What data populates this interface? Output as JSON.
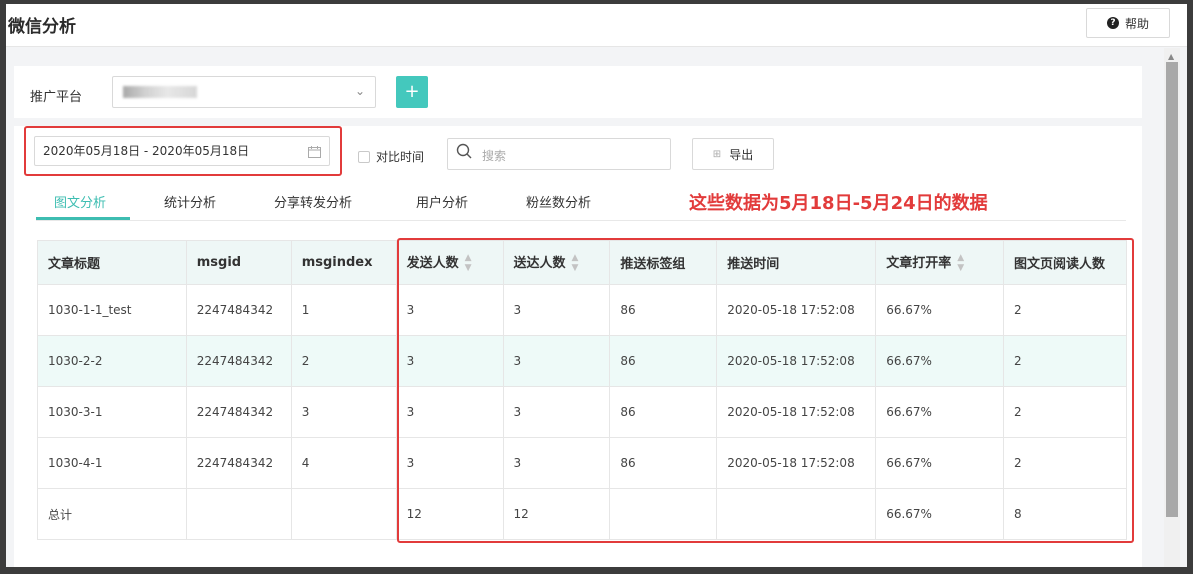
{
  "header": {
    "title": "微信分析",
    "help_label": "帮助"
  },
  "filters": {
    "platform_label": "推广平台",
    "date_range": "2020年05月18日 - 2020年05月18日",
    "compare_label": "对比时间",
    "search_placeholder": "搜索",
    "export_label": "导出"
  },
  "tabs": [
    {
      "label": "图文分析",
      "active": true
    },
    {
      "label": "统计分析"
    },
    {
      "label": "分享转发分析"
    },
    {
      "label": "用户分析"
    },
    {
      "label": "粉丝数分析"
    }
  ],
  "annotation": "这些数据为5月18日-5月24日的数据",
  "table": {
    "columns": [
      "文章标题",
      "msgid",
      "msgindex",
      "发送人数",
      "送达人数",
      "推送标签组",
      "推送时间",
      "文章打开率",
      "图文页阅读人数"
    ],
    "rows": [
      [
        "1030-1-1_test",
        "2247484342",
        "1",
        "3",
        "3",
        "86",
        "2020-05-18 17:52:08",
        "66.67%",
        "2"
      ],
      [
        "1030-2-2",
        "2247484342",
        "2",
        "3",
        "3",
        "86",
        "2020-05-18 17:52:08",
        "66.67%",
        "2"
      ],
      [
        "1030-3-1",
        "2247484342",
        "3",
        "3",
        "3",
        "86",
        "2020-05-18 17:52:08",
        "66.67%",
        "2"
      ],
      [
        "1030-4-1",
        "2247484342",
        "4",
        "3",
        "3",
        "86",
        "2020-05-18 17:52:08",
        "66.67%",
        "2"
      ],
      [
        "总计",
        "",
        "",
        "12",
        "12",
        "",
        "",
        "66.67%",
        "8"
      ]
    ]
  },
  "colors": {
    "accent": "#3dbdb1",
    "highlight": "#e23b3b",
    "row_alt": "#eefaf8"
  }
}
